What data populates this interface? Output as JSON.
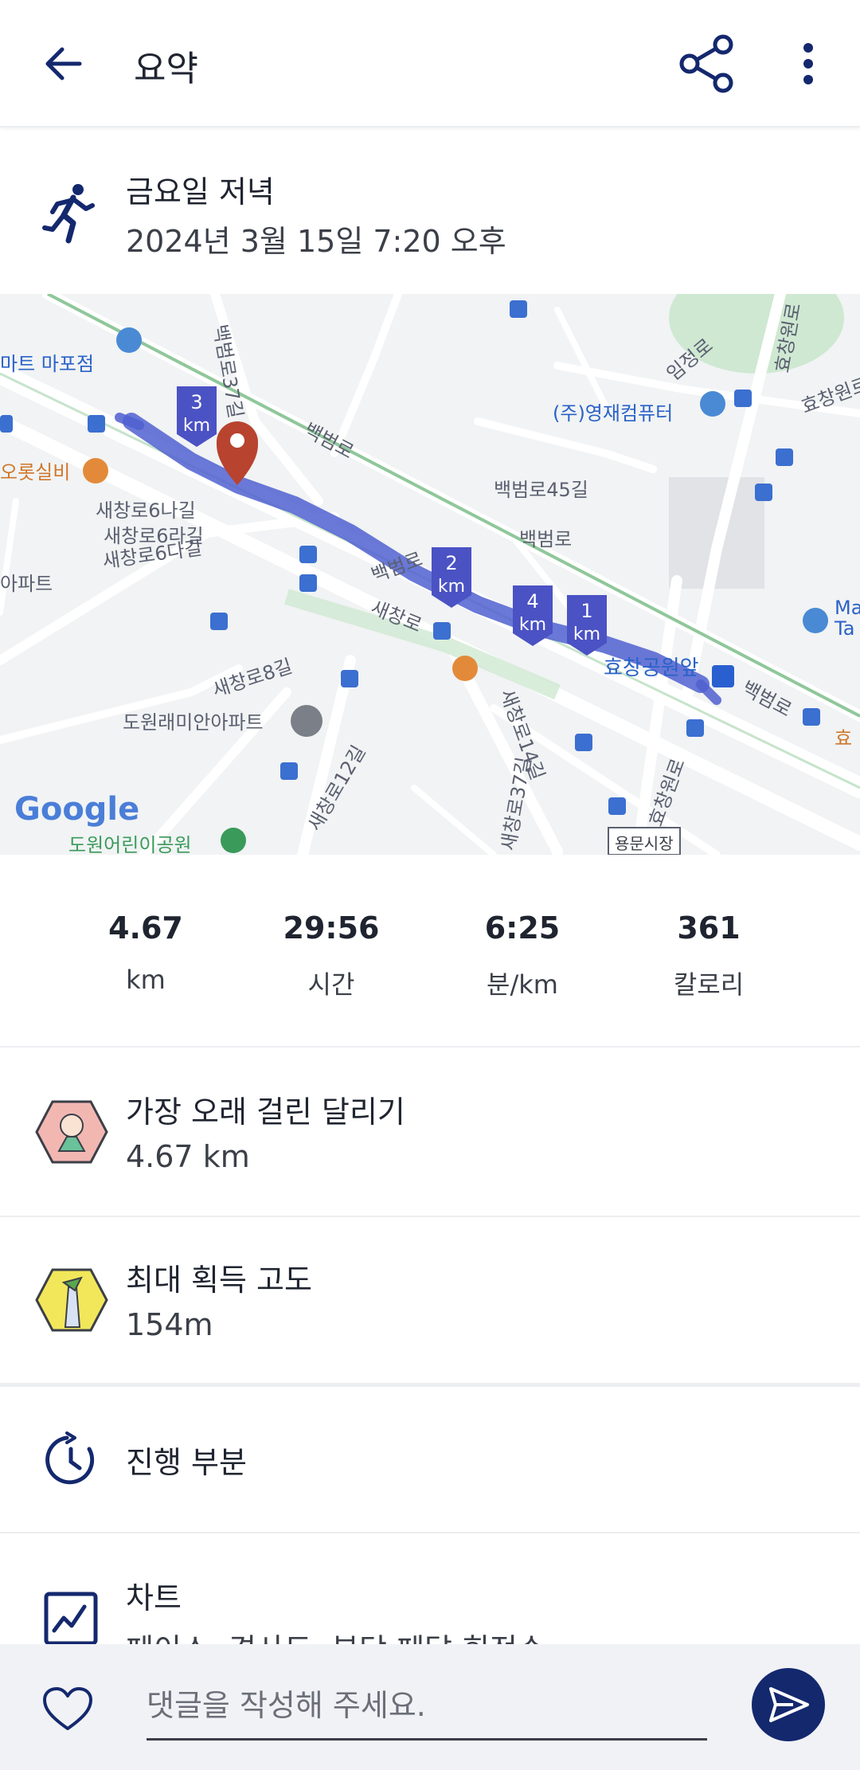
{
  "header": {
    "title": "요약",
    "back_icon": "arrow-left-icon",
    "share_icon": "share-icon",
    "more_icon": "more-vertical-icon"
  },
  "activity": {
    "name": "금요일 저녁",
    "datetime": "2024년 3월 15일 7:20 오후",
    "icon": "running-person-icon"
  },
  "map": {
    "labels": {
      "mart": "마트 마포점",
      "orosil": "오롯실비",
      "yj": "(주)영재컴퓨터",
      "baekbeom1": "백범로",
      "baekbeom2": "백범로",
      "baekbeom3": "백범로",
      "baekbeom4": "백범로",
      "baekbeom45": "백범로45길",
      "saechang6na": "새창로6나길",
      "saechang6ra": "새창로6라길",
      "saechang6da": "새창로6다길",
      "saechang": "새창로",
      "saechang8": "새창로8길",
      "saechang12": "새창로12길",
      "saechang14": "새창로14길",
      "saechang37": "새창로37길",
      "apt": "아파트",
      "dowon_apt": "도원래미안아파트",
      "dowon_park": "도원어린이공원",
      "hyochang_station": "효창공원앞",
      "hyochangwon": "효창원로",
      "hyochangwon2": "효창원로",
      "imjeong": "임정로",
      "yongmun": "용문시장",
      "baekbeom37": "백범로37길",
      "google": "Google",
      "ma": "Ma",
      "ta": "Ta",
      "hyo_right": "효창원로",
      "orange_right": "효"
    },
    "markers": [
      {
        "n": "3",
        "unit": "km"
      },
      {
        "n": "2",
        "unit": "km"
      },
      {
        "n": "4",
        "unit": "km"
      },
      {
        "n": "1",
        "unit": "km"
      }
    ],
    "route_color": "#5060d0",
    "marker_color": "#4b52c4",
    "pin_color": "#b8432f"
  },
  "stats": [
    {
      "value": "4.67",
      "label": "km"
    },
    {
      "value": "29:56",
      "label": "시간"
    },
    {
      "value": "6:25",
      "label": "분/km"
    },
    {
      "value": "361",
      "label": "칼로리"
    }
  ],
  "achievements": [
    {
      "title": "가장 오래 걸린 달리기",
      "value": "4.67 km",
      "icon": "longest-run-badge-icon"
    },
    {
      "title": "최대 획득 고도",
      "value": "154m",
      "icon": "elevation-badge-icon"
    }
  ],
  "sections": {
    "splits": {
      "label": "진행 부분",
      "icon": "timer-icon"
    },
    "charts": {
      "label": "차트",
      "sub": "페이스, 경사도, 분당 페달 회전수",
      "icon": "chart-icon"
    }
  },
  "comment": {
    "placeholder": "댓글을 작성해 주세요.",
    "heart_icon": "heart-icon",
    "send_icon": "send-icon"
  }
}
